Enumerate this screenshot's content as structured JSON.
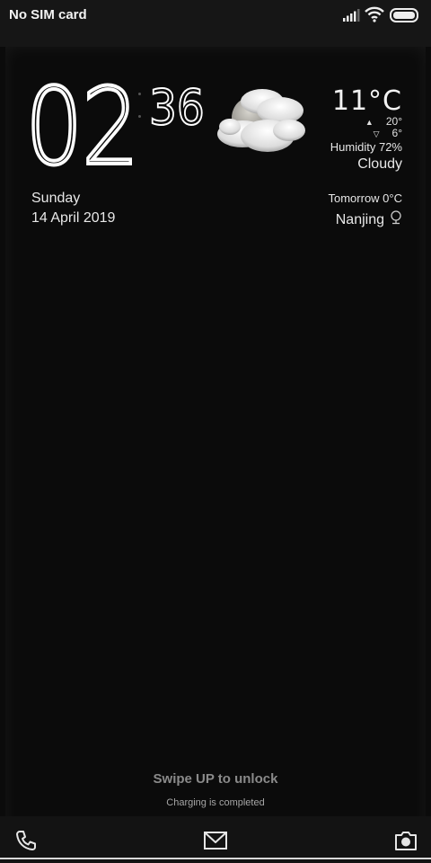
{
  "status_bar": {
    "carrier": "No SIM card",
    "icons": [
      "signal-icon",
      "wifi-icon",
      "battery-icon"
    ]
  },
  "clock": {
    "hours": "02",
    "minutes": "36"
  },
  "date": {
    "day": "Sunday",
    "full": "14 April 2019"
  },
  "weather": {
    "icon": "cloudy-night-icon",
    "temperature": "11°C",
    "high": "20°",
    "low": "6°",
    "humidity": "Humidity 72%",
    "condition": "Cloudy",
    "tomorrow": "Tomorrow 0°C",
    "location": "Nanjing"
  },
  "lockscreen": {
    "swipe_hint": "Swipe UP to unlock",
    "charging": "Charging is completed"
  },
  "dock": {
    "buttons": [
      "phone-icon",
      "message-icon",
      "camera-icon"
    ]
  },
  "colors": {
    "background": "#0b0b0b",
    "status_bar": "#161616",
    "text": "#ffffff",
    "hint": "#8a8a8a"
  }
}
